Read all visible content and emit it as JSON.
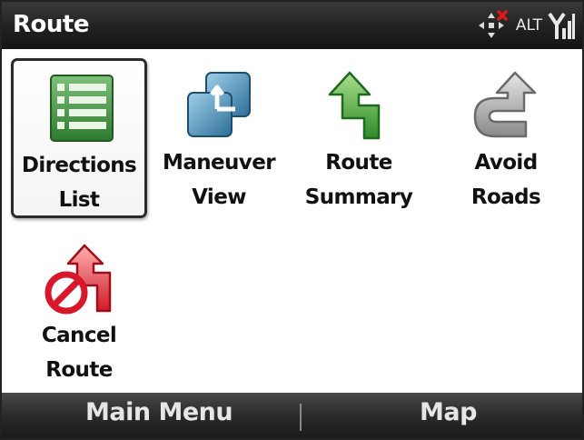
{
  "app": {
    "title": "Route"
  },
  "status": {
    "alt_label": "ALT",
    "icons": [
      "data-connection-off-icon",
      "signal-strength-icon"
    ]
  },
  "menu": {
    "items": [
      {
        "id": "directions-list",
        "line1": "Directions",
        "line2": "List",
        "icon": "list-icon",
        "selected": true
      },
      {
        "id": "maneuver-view",
        "line1": "Maneuver",
        "line2": "View",
        "icon": "turn-arrow-icon",
        "selected": false
      },
      {
        "id": "route-summary",
        "line1": "Route",
        "line2": "Summary",
        "icon": "green-route-arrow-icon",
        "selected": false
      },
      {
        "id": "avoid-roads",
        "line1": "Avoid",
        "line2": "Roads",
        "icon": "gray-route-arrow-icon",
        "selected": false
      },
      {
        "id": "cancel-route",
        "line1": "Cancel",
        "line2": "Route",
        "icon": "cancel-route-icon",
        "selected": false
      }
    ]
  },
  "softkeys": {
    "left": "Main Menu",
    "right": "Map"
  },
  "colors": {
    "selection_border": "#2a2a2a",
    "list_green": "#3a8a3a",
    "route_green": "#4cae3a",
    "route_gray": "#9a9a9a",
    "cancel_red": "#d8182a",
    "maneuver_blue": "#3f7fa8"
  }
}
